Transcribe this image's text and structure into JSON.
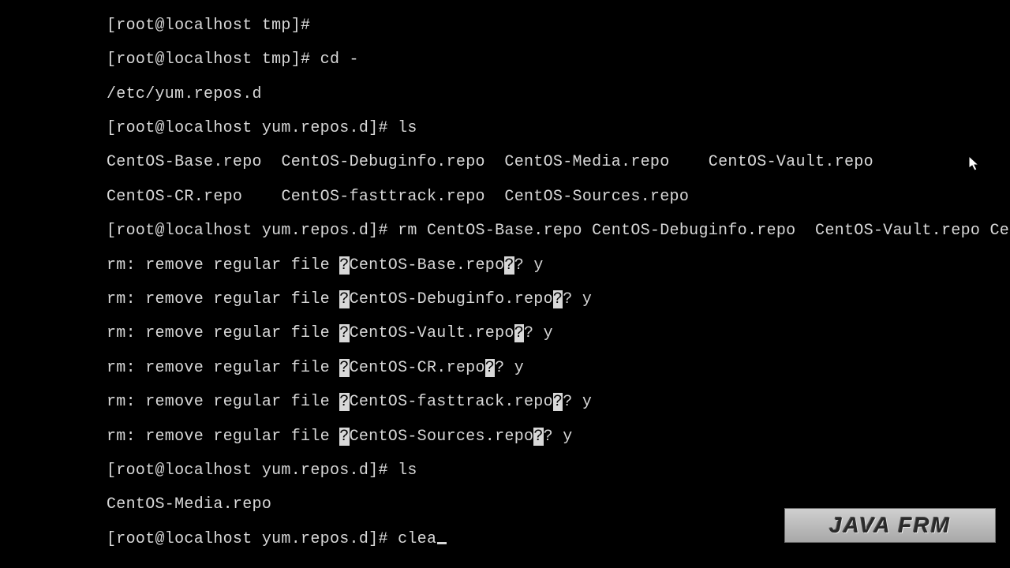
{
  "prompt_tmp": "[root@localhost tmp]#",
  "prompt_repos": "[root@localhost yum.repos.d]#",
  "cmd_cd": "cd -",
  "cd_output": "/etc/yum.repos.d",
  "cmd_ls": "ls",
  "ls1": {
    "row1": [
      "CentOS-Base.repo",
      "CentOS-Debuginfo.repo",
      "CentOS-Media.repo",
      "CentOS-Vault.repo"
    ],
    "row2": [
      "CentOS-CR.repo",
      "CentOS-fasttrack.repo",
      "CentOS-Sources.repo"
    ]
  },
  "cmd_rm": "rm CentOS-Base.repo CentOS-Debuginfo.repo  CentOS-Vault.repo CentOS-CR.repo  CentOS-fasttrack.repo CentOS-Sources.repo",
  "rm_prefix": "rm: remove regular file ",
  "rm_items": [
    {
      "file": "CentOS-Base.repo",
      "answer": "y"
    },
    {
      "file": "CentOS-Debuginfo.repo",
      "answer": "y"
    },
    {
      "file": "CentOS-Vault.repo",
      "answer": "y"
    },
    {
      "file": "CentOS-CR.repo",
      "answer": "y"
    },
    {
      "file": "CentOS-fasttrack.repo",
      "answer": "y"
    },
    {
      "file": "CentOS-Sources.repo",
      "answer": "y"
    }
  ],
  "ls2_output": "CentOS-Media.repo",
  "cmd_current": "clea",
  "watermark": "JAVA FRM"
}
